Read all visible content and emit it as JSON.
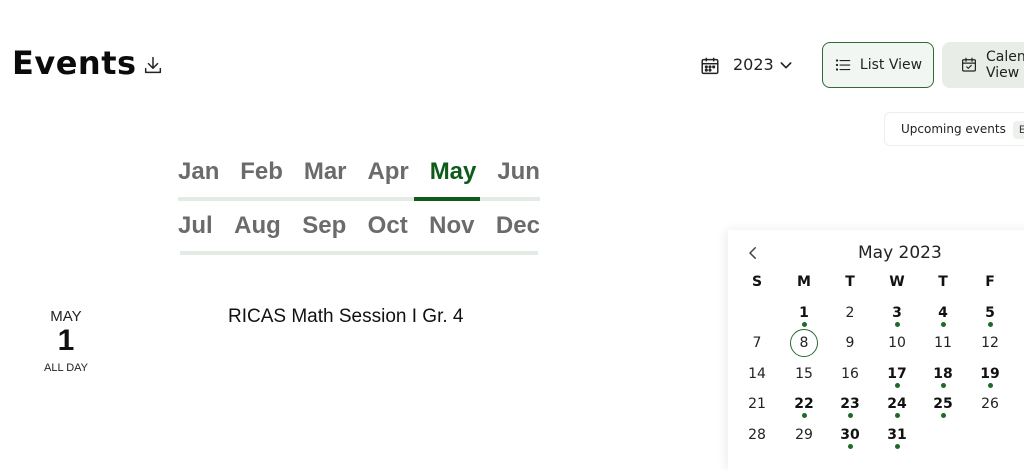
{
  "header": {
    "title": "Events",
    "year": "2023",
    "list_view_label": "List View",
    "calendar_view_label": "Calendar View",
    "upcoming_label": "Upcoming events",
    "chip_label": "E"
  },
  "months": {
    "row1": [
      "Jan",
      "Feb",
      "Mar",
      "Apr",
      "May",
      "Jun"
    ],
    "row2": [
      "Jul",
      "Aug",
      "Sep",
      "Oct",
      "Nov",
      "Dec"
    ],
    "selected": "May"
  },
  "event": {
    "month": "MAY",
    "day": "1",
    "time": "ALL DAY",
    "title": "RICAS Math Session I Gr. 4"
  },
  "mini_calendar": {
    "title": "May 2023",
    "weekdays": [
      "S",
      "M",
      "T",
      "W",
      "T",
      "F"
    ],
    "today": 8,
    "event_days": [
      1,
      3,
      4,
      5,
      17,
      18,
      19,
      22,
      23,
      24,
      25,
      30,
      31
    ],
    "weeks": [
      [
        "",
        "1",
        "2",
        "3",
        "4",
        "5"
      ],
      [
        "7",
        "8",
        "9",
        "10",
        "11",
        "12"
      ],
      [
        "14",
        "15",
        "16",
        "17",
        "18",
        "19"
      ],
      [
        "21",
        "22",
        "23",
        "24",
        "25",
        "26"
      ],
      [
        "28",
        "29",
        "30",
        "31",
        "",
        ""
      ]
    ]
  },
  "colors": {
    "accent": "#0e5b1a",
    "event_dot": "#1d6b27"
  }
}
